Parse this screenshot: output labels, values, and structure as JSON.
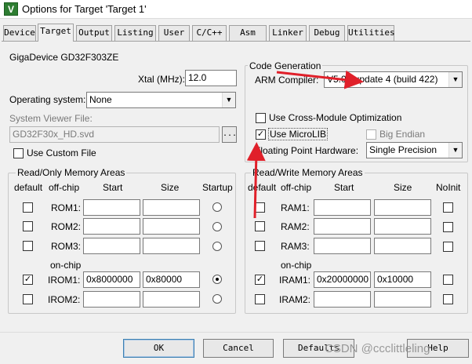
{
  "window": {
    "title": "Options for Target 'Target 1'",
    "app_icon": "V"
  },
  "tabs": [
    {
      "label": "Device"
    },
    {
      "label": "Target"
    },
    {
      "label": "Output"
    },
    {
      "label": "Listing"
    },
    {
      "label": "User"
    },
    {
      "label": "C/C++"
    },
    {
      "label": "Asm"
    },
    {
      "label": "Linker"
    },
    {
      "label": "Debug"
    },
    {
      "label": "Utilities"
    }
  ],
  "device": {
    "name": "GigaDevice GD32F303ZE"
  },
  "xtal": {
    "label": "Xtal (MHz):",
    "value": "12.0"
  },
  "os": {
    "label": "Operating system:",
    "value": "None"
  },
  "svf": {
    "label": "System Viewer File:",
    "value": "GD32F30x_HD.svd",
    "browse": "...",
    "custom_label": "Use Custom File"
  },
  "codegen": {
    "title": "Code Generation",
    "compiler_label": "ARM Compiler:",
    "compiler_value": "V5.06 update 4 (build 422)",
    "cross_module": "Use Cross-Module Optimization",
    "microlib": "Use MicroLIB",
    "big_endian": "Big Endian",
    "fp_label": "Floating Point Hardware:",
    "fp_value": "Single Precision"
  },
  "rom": {
    "title": "Read/Only Memory Areas",
    "headers": {
      "default": "default",
      "offchip": "off-chip",
      "start": "Start",
      "size": "Size",
      "startup": "Startup"
    },
    "onchip_label": "on-chip",
    "rows": [
      {
        "label": "ROM1:",
        "start": "",
        "size": "",
        "default": false,
        "startup": false
      },
      {
        "label": "ROM2:",
        "start": "",
        "size": "",
        "default": false,
        "startup": false
      },
      {
        "label": "ROM3:",
        "start": "",
        "size": "",
        "default": false,
        "startup": false
      },
      {
        "label": "IROM1:",
        "start": "0x8000000",
        "size": "0x80000",
        "default": true,
        "startup": true
      },
      {
        "label": "IROM2:",
        "start": "",
        "size": "",
        "default": false,
        "startup": false
      }
    ]
  },
  "ram": {
    "title": "Read/Write Memory Areas",
    "headers": {
      "default": "default",
      "offchip": "off-chip",
      "start": "Start",
      "size": "Size",
      "noinit": "NoInit"
    },
    "onchip_label": "on-chip",
    "rows": [
      {
        "label": "RAM1:",
        "start": "",
        "size": "",
        "default": false,
        "noinit": false
      },
      {
        "label": "RAM2:",
        "start": "",
        "size": "",
        "default": false,
        "noinit": false
      },
      {
        "label": "RAM3:",
        "start": "",
        "size": "",
        "default": false,
        "noinit": false
      },
      {
        "label": "IRAM1:",
        "start": "0x20000000",
        "size": "0x10000",
        "default": true,
        "noinit": false
      },
      {
        "label": "IRAM2:",
        "start": "",
        "size": "",
        "default": false,
        "noinit": false
      }
    ]
  },
  "buttons": {
    "ok": "OK",
    "cancel": "Cancel",
    "defaults": "Defaults",
    "help": "Help"
  },
  "watermark": "CSDN @ccclittleling",
  "colors": {
    "annotation": "#e0202a",
    "default_button_border": "#3c7fb1"
  }
}
